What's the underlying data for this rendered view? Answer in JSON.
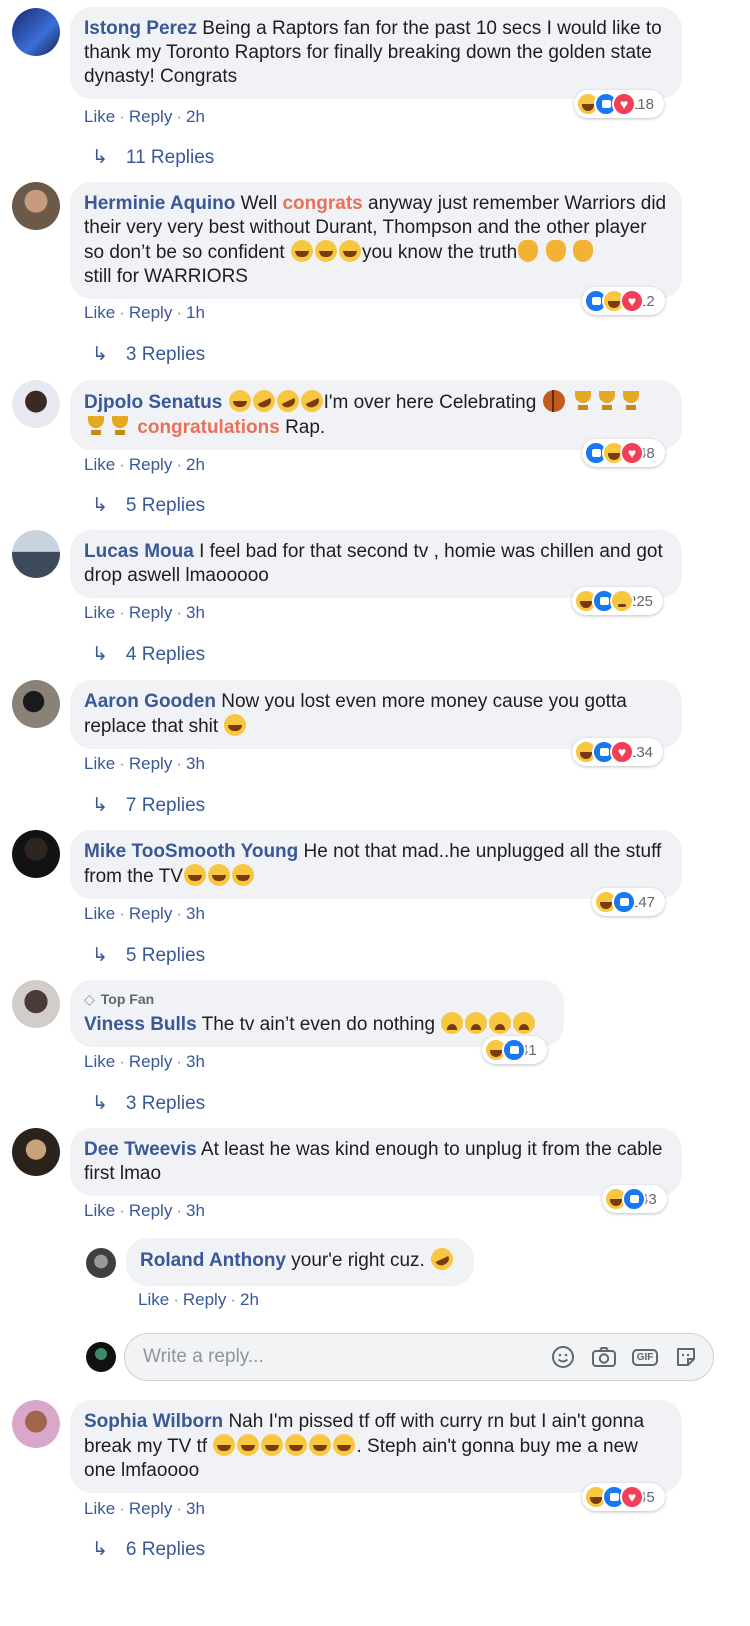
{
  "comments": [
    {
      "author": "Istong Perez",
      "text": "Being a Raptors fan for the past 10 secs I would like to thank my Toronto Raptors for finally breaking down the golden state dynasty! Congrats",
      "like": "Like",
      "reply": "Reply",
      "time": "2h",
      "reactions_count": "118",
      "reactions": [
        "haha",
        "like",
        "love"
      ],
      "replies": "11 Replies"
    },
    {
      "author": "Herminie Aquino",
      "text_a": "Well ",
      "highlight": "congrats",
      "text_b": " anyway just remember Warriors did their very very best without Durant, Thompson and the other player so don’t be so confident ",
      "text_c": "you know the truth",
      "text_d": "still for WARRIORS",
      "like": "Like",
      "reply": "Reply",
      "time": "1h",
      "reactions_count": "12",
      "reactions": [
        "like",
        "haha",
        "love"
      ],
      "replies": "3 Replies"
    },
    {
      "author": "Djpolo Senatus",
      "text_a": "I'm over here Celebrating ",
      "highlight": "congratulations",
      "text_b": " Rap.",
      "like": "Like",
      "reply": "Reply",
      "time": "2h",
      "reactions_count": "48",
      "reactions": [
        "like",
        "haha",
        "love"
      ],
      "replies": "5 Replies"
    },
    {
      "author": "Lucas Moua",
      "text": "I feel bad for that second tv , homie was chillen and got drop aswell lmaooooo",
      "like": "Like",
      "reply": "Reply",
      "time": "3h",
      "reactions_count": "225",
      "reactions": [
        "haha",
        "like",
        "sad"
      ],
      "replies": "4 Replies"
    },
    {
      "author": "Aaron Gooden",
      "text": "Now you lost even more money cause you gotta replace that shit",
      "like": "Like",
      "reply": "Reply",
      "time": "3h",
      "reactions_count": "134",
      "reactions": [
        "haha",
        "like",
        "love"
      ],
      "replies": "7 Replies"
    },
    {
      "author": "Mike TooSmooth Young",
      "text": "He not that mad..he unplugged all the stuff from the TV",
      "like": "Like",
      "reply": "Reply",
      "time": "3h",
      "reactions_count": "147",
      "reactions": [
        "haha",
        "like"
      ],
      "replies": "5 Replies"
    },
    {
      "badge": "Top Fan",
      "author": "Viness Bulls",
      "text": "The tv ain’t even do nothing",
      "like": "Like",
      "reply": "Reply",
      "time": "3h",
      "reactions_count": "41",
      "reactions": [
        "haha",
        "like"
      ],
      "replies": "3 Replies"
    },
    {
      "author": "Dee Tweevis",
      "text": "At least he was kind enough to unplug it from the cable first lmao",
      "like": "Like",
      "reply": "Reply",
      "time": "3h",
      "reactions_count": "43",
      "reactions": [
        "haha",
        "like"
      ]
    },
    {
      "author": "Sophia Wilborn",
      "text_a": "Nah I'm pissed tf off with curry rn but I ain't gonna break my TV tf ",
      "text_b": ". Steph ain't gonna buy me a new one lmfaoooo",
      "like": "Like",
      "reply": "Reply",
      "time": "3h",
      "reactions_count": "45",
      "reactions": [
        "haha",
        "like",
        "love"
      ],
      "replies": "6 Replies"
    }
  ],
  "nested_reply": {
    "author": "Roland Anthony",
    "text": "your'e right cuz.",
    "like": "Like",
    "reply": "Reply",
    "time": "2h"
  },
  "reply_box": {
    "placeholder": "Write a reply..."
  },
  "colors": {
    "author_link": "#385898",
    "highlight": "#e9715a",
    "bubble_bg": "#f0f2f5"
  }
}
